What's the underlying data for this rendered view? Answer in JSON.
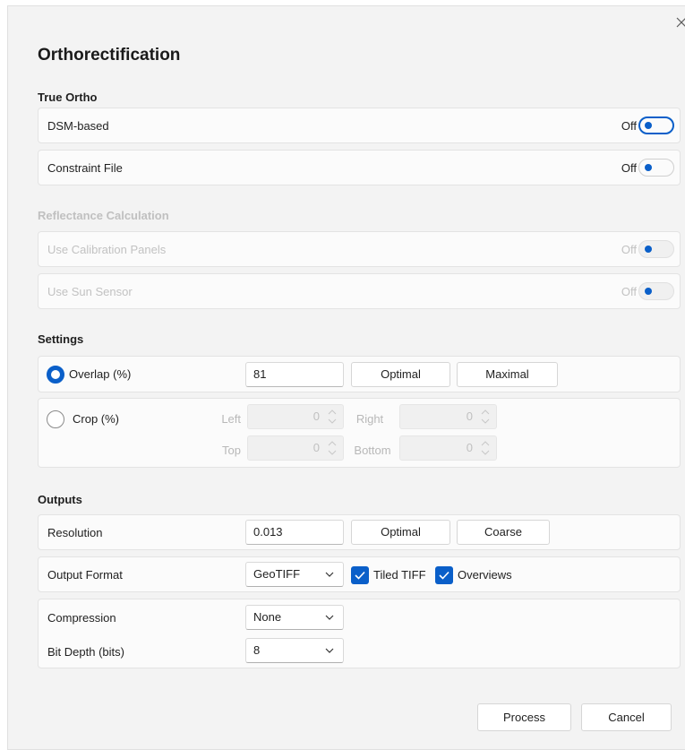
{
  "dialog": {
    "title": "Orthorectification",
    "close_icon": "close-icon"
  },
  "true_ortho": {
    "heading": "True Ortho",
    "dsm_label": "DSM-based",
    "dsm_state": "Off",
    "constraint_label": "Constraint File",
    "constraint_state": "Off"
  },
  "reflectance": {
    "heading": "Reflectance Calculation",
    "calibration_label": "Use Calibration Panels",
    "calibration_state": "Off",
    "sun_label": "Use Sun Sensor",
    "sun_state": "Off"
  },
  "settings": {
    "heading": "Settings",
    "overlap_label": "Overlap (%)",
    "overlap_value": "81",
    "optimal_label": "Optimal",
    "maximal_label": "Maximal",
    "crop_label": "Crop (%)",
    "left_label": "Left",
    "left_value": "0",
    "right_label": "Right",
    "right_value": "0",
    "top_label": "Top",
    "top_value": "0",
    "bottom_label": "Bottom",
    "bottom_value": "0"
  },
  "outputs": {
    "heading": "Outputs",
    "resolution_label": "Resolution",
    "resolution_value": "0.013",
    "res_optimal_label": "Optimal",
    "res_coarse_label": "Coarse",
    "format_label": "Output Format",
    "format_value": "GeoTIFF",
    "tiled_label": "Tiled TIFF",
    "tiled_checked": true,
    "overviews_label": "Overviews",
    "overviews_checked": true,
    "compression_label": "Compression",
    "compression_value": "None",
    "bitdepth_label": "Bit Depth (bits)",
    "bitdepth_value": "8"
  },
  "footer": {
    "process_label": "Process",
    "cancel_label": "Cancel"
  },
  "colors": {
    "accent": "#0a5fc9",
    "background": "#f3f3f3",
    "card": "#fbfbfb"
  }
}
